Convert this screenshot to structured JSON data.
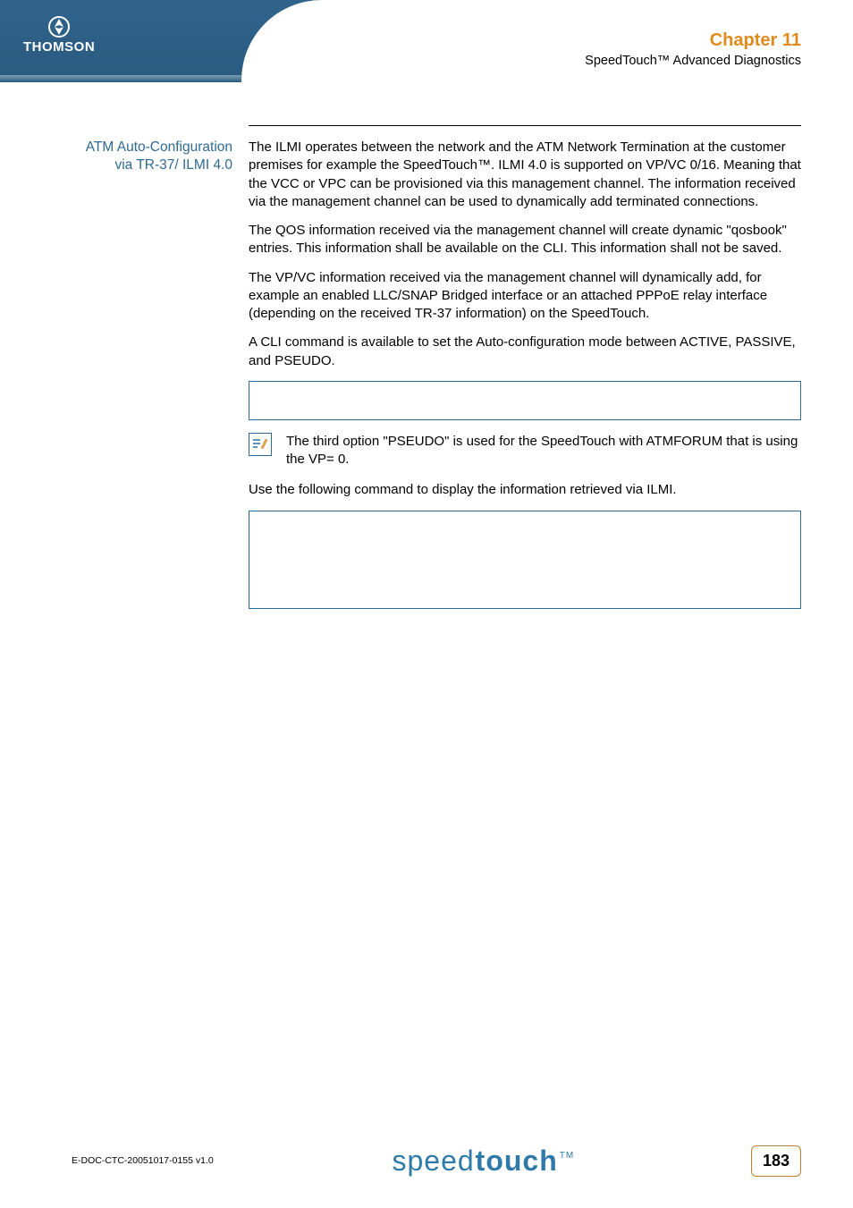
{
  "brand": "THOMSON",
  "chapter": {
    "label": "Chapter 11",
    "subtitle": "SpeedTouch™ Advanced Diagnostics"
  },
  "section_heading_line1": "ATM Auto-Configuration",
  "section_heading_line2": "via TR-37/ ILMI 4.0",
  "paragraphs": {
    "p1": "The ILMI operates between the network and the ATM Network Termination at the customer premises for example the SpeedTouch™. ILMI 4.0 is supported on VP/VC 0/16. Meaning that the VCC or VPC can be provisioned via this management channel. The information received via the management channel can be used to dynamically add terminated connections.",
    "p2": "The QOS information received via the management channel will create dynamic \"qosbook\" entries.  This information shall be available on the CLI. This information shall not be saved.",
    "p3": "The VP/VC information received via the management channel will dynamically add, for example an enabled LLC/SNAP Bridged interface or an attached PPPoE relay interface (depending on the received TR-37 information) on the SpeedTouch.",
    "p4": "A CLI command is available to set the Auto-configuration mode between ACTIVE, PASSIVE, and PSEUDO.",
    "note": "The third option \"PSEUDO\" is used for the SpeedTouch with ATMFORUM that is using the VP= 0.",
    "p5": "Use the following command to display the information retrieved via ILMI."
  },
  "footer": {
    "doc_id": "E-DOC-CTC-20051017-0155 v1.0",
    "logo_light": "speed",
    "logo_bold": "touch",
    "tm": "TM",
    "page_number": "183"
  }
}
